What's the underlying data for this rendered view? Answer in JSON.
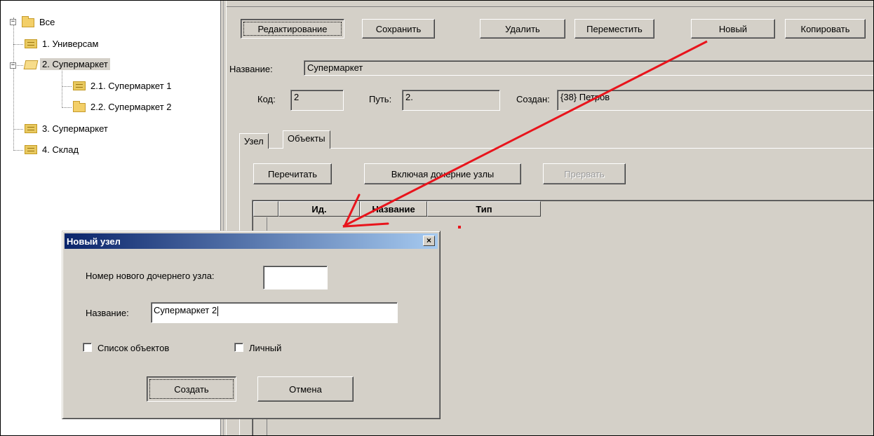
{
  "tree": {
    "items": [
      {
        "label": "Все",
        "icon": "folder-icon"
      },
      {
        "label": "1. Универсам",
        "icon": "document-icon"
      },
      {
        "label": "2. Супермаркет",
        "icon": "folder-open-icon"
      },
      {
        "label": "2.1. Супермаркет 1",
        "icon": "document-icon"
      },
      {
        "label": "2.2. Супермаркет 2",
        "icon": "folder-icon"
      },
      {
        "label": "3. Супермаркет",
        "icon": "document-icon"
      },
      {
        "label": "4. Склад",
        "icon": "document-icon"
      }
    ]
  },
  "toolbar": {
    "edit_label": "Редактирование",
    "save_label": "Сохранить",
    "delete_label": "Удалить",
    "move_label": "Переместить",
    "new_label": "Новый",
    "copy_label": "Копировать"
  },
  "node": {
    "name_label": "Название:",
    "name_value": "Супермаркет",
    "code_label": "Код:",
    "code_value": "2",
    "path_label": "Путь:",
    "path_value": "2.",
    "created_label": "Создан:",
    "created_value": "{38} Петров"
  },
  "tabs": [
    {
      "label": "Узел"
    },
    {
      "label": "Объекты"
    }
  ],
  "objects": {
    "reread_label": "Перечитать",
    "include_children_label": "Включая дочерние узлы",
    "abort_label": "Прервать",
    "columns": [
      "Ид.",
      "Название",
      "Тип"
    ]
  },
  "dialog": {
    "title": "Новый узел",
    "close_glyph": "×",
    "number_label": "Номер нового дочернего узла:",
    "number_value": "",
    "name_label": "Название:",
    "name_value": "Супермаркет 2",
    "objects_list_label": "Список объектов",
    "objects_list_checked": false,
    "personal_label": "Личный",
    "personal_checked": false,
    "create_label": "Создать",
    "cancel_label": "Отмена"
  },
  "colors": {
    "titlebar_start": "#0a246a",
    "titlebar_end": "#a6caf0",
    "annotation": "#e8141c",
    "face": "#d4d0c8"
  }
}
